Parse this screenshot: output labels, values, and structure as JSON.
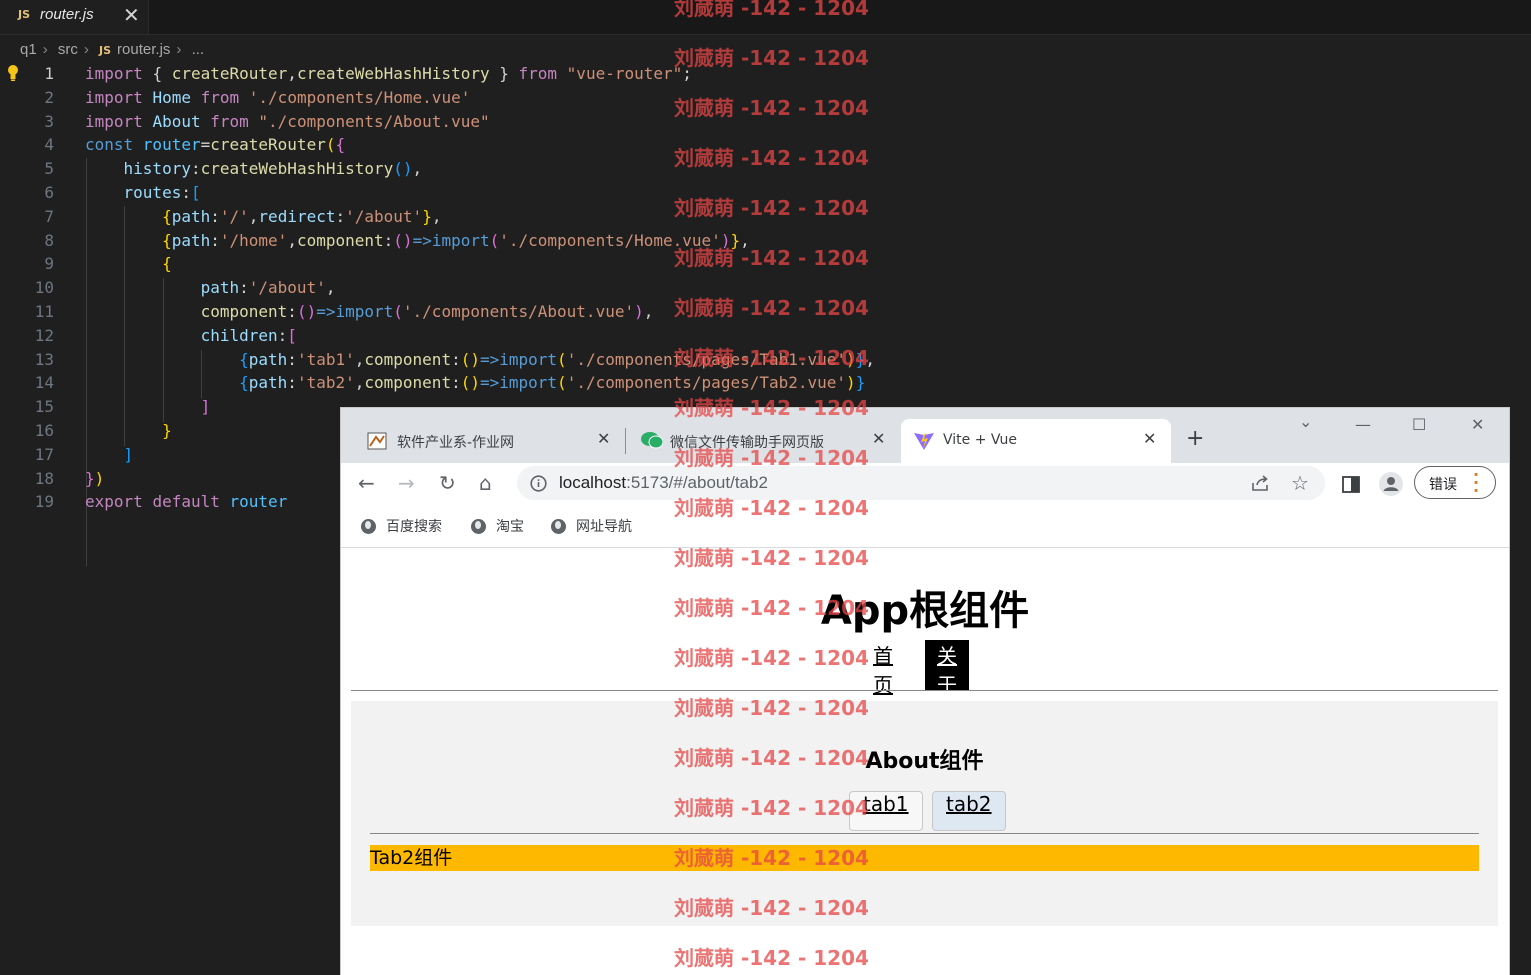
{
  "editor": {
    "tab_label": "router.js",
    "tab_lang": "JS",
    "tab_close": "✕",
    "breadcrumb": {
      "folder": "q1",
      "subfolder": "src",
      "lang": "JS",
      "file": "router.js",
      "more": "..."
    },
    "line_numbers": [
      "1",
      "2",
      "3",
      "4",
      "5",
      "6",
      "7",
      "8",
      "9",
      "10",
      "11",
      "12",
      "13",
      "14",
      "15",
      "16",
      "17",
      "18",
      "19"
    ],
    "code_lines": [
      [
        [
          "kw",
          "import "
        ],
        [
          "pl",
          "{ "
        ],
        [
          "fn",
          "createRouter"
        ],
        [
          "pl",
          ","
        ],
        [
          "fn",
          "createWebHashHistory"
        ],
        [
          "pl",
          " } "
        ],
        [
          "kw",
          "from "
        ],
        [
          "st",
          "\"vue-router\""
        ],
        [
          "pl",
          ";"
        ]
      ],
      [
        [
          "kw",
          "import "
        ],
        [
          "vr",
          "Home "
        ],
        [
          "kw",
          "from "
        ],
        [
          "st",
          "'./components/Home.vue'"
        ]
      ],
      [
        [
          "kw",
          "import "
        ],
        [
          "vr",
          "About "
        ],
        [
          "kw",
          "from "
        ],
        [
          "st",
          "\"./components/About.vue\""
        ]
      ],
      [
        [
          "kb",
          "const "
        ],
        [
          "cv",
          "router"
        ],
        [
          "pl",
          "="
        ],
        [
          "fn",
          "createRouter"
        ],
        [
          "b1",
          "("
        ],
        [
          "b2",
          "{"
        ]
      ],
      [
        [
          "pl",
          "    "
        ],
        [
          "vr",
          "history"
        ],
        [
          "pl",
          ":"
        ],
        [
          "fn",
          "createWebHashHistory"
        ],
        [
          "b3",
          "()"
        ],
        [
          "pl",
          ","
        ]
      ],
      [
        [
          "pl",
          "    "
        ],
        [
          "vr",
          "routes"
        ],
        [
          "pl",
          ":"
        ],
        [
          "b3",
          "["
        ]
      ],
      [
        [
          "pl",
          "        "
        ],
        [
          "b1",
          "{"
        ],
        [
          "vr",
          "path"
        ],
        [
          "pl",
          ":"
        ],
        [
          "st",
          "'/'"
        ],
        [
          "pl",
          ","
        ],
        [
          "vr",
          "redirect"
        ],
        [
          "pl",
          ":"
        ],
        [
          "st",
          "'/about'"
        ],
        [
          "b1",
          "}"
        ],
        [
          "pl",
          ","
        ]
      ],
      [
        [
          "pl",
          "        "
        ],
        [
          "b1",
          "{"
        ],
        [
          "vr",
          "path"
        ],
        [
          "pl",
          ":"
        ],
        [
          "st",
          "'/home'"
        ],
        [
          "pl",
          ","
        ],
        [
          "fn",
          "component"
        ],
        [
          "pl",
          ":"
        ],
        [
          "b2",
          "()"
        ],
        [
          "kb",
          "=>"
        ],
        [
          "kb",
          "import"
        ],
        [
          "b2",
          "("
        ],
        [
          "st",
          "'./components/Home.vue'"
        ],
        [
          "b2",
          ")"
        ],
        [
          "b1",
          "}"
        ],
        [
          "pl",
          ","
        ]
      ],
      [
        [
          "pl",
          "        "
        ],
        [
          "b1",
          "{"
        ]
      ],
      [
        [
          "pl",
          "            "
        ],
        [
          "vr",
          "path"
        ],
        [
          "pl",
          ":"
        ],
        [
          "st",
          "'/about'"
        ],
        [
          "pl",
          ","
        ]
      ],
      [
        [
          "pl",
          "            "
        ],
        [
          "fn",
          "component"
        ],
        [
          "pl",
          ":"
        ],
        [
          "b2",
          "()"
        ],
        [
          "kb",
          "=>"
        ],
        [
          "kb",
          "import"
        ],
        [
          "b2",
          "("
        ],
        [
          "st",
          "'./components/About.vue'"
        ],
        [
          "b2",
          ")"
        ],
        [
          "pl",
          ","
        ]
      ],
      [
        [
          "pl",
          "            "
        ],
        [
          "vr",
          "children"
        ],
        [
          "pl",
          ":"
        ],
        [
          "b2",
          "["
        ]
      ],
      [
        [
          "pl",
          "                "
        ],
        [
          "b3",
          "{"
        ],
        [
          "vr",
          "path"
        ],
        [
          "pl",
          ":"
        ],
        [
          "st",
          "'tab1'"
        ],
        [
          "pl",
          ","
        ],
        [
          "fn",
          "component"
        ],
        [
          "pl",
          ":"
        ],
        [
          "b1",
          "()"
        ],
        [
          "kb",
          "=>"
        ],
        [
          "kb",
          "import"
        ],
        [
          "b1",
          "("
        ],
        [
          "st",
          "'./components/pages/Tab1.vue'"
        ],
        [
          "b1",
          ")"
        ],
        [
          "b3",
          "}"
        ],
        [
          "pl",
          ","
        ]
      ],
      [
        [
          "pl",
          "                "
        ],
        [
          "b3",
          "{"
        ],
        [
          "vr",
          "path"
        ],
        [
          "pl",
          ":"
        ],
        [
          "st",
          "'tab2'"
        ],
        [
          "pl",
          ","
        ],
        [
          "fn",
          "component"
        ],
        [
          "pl",
          ":"
        ],
        [
          "b1",
          "()"
        ],
        [
          "kb",
          "=>"
        ],
        [
          "kb",
          "import"
        ],
        [
          "b1",
          "("
        ],
        [
          "st",
          "'./components/pages/Tab2.vue'"
        ],
        [
          "b1",
          ")"
        ],
        [
          "b3",
          "}"
        ]
      ],
      [
        [
          "pl",
          "            "
        ],
        [
          "b2",
          "]"
        ]
      ],
      [
        [
          "pl",
          "        "
        ],
        [
          "b1",
          "}"
        ]
      ],
      [
        [
          "pl",
          "    "
        ],
        [
          "b3",
          "]"
        ]
      ],
      [
        [
          "b2",
          "}"
        ],
        [
          "b1",
          ")"
        ]
      ],
      [
        [
          "kw",
          "export "
        ],
        [
          "kw",
          "default "
        ],
        [
          "cv",
          "router"
        ]
      ]
    ]
  },
  "browser": {
    "tabs": [
      {
        "label": "软件产业系-作业网",
        "close": "✕"
      },
      {
        "label": "微信文件传输助手网页版",
        "close": "✕"
      },
      {
        "label": "Vite + Vue",
        "close": "✕"
      }
    ],
    "new_tab": "+",
    "window_controls": {
      "dropdown": "⌄",
      "minimize": "—",
      "maximize": "☐",
      "close": "✕"
    },
    "nav": {
      "back": "←",
      "forward": "→",
      "reload": "↻",
      "home": "⌂"
    },
    "address": {
      "host": "localhost",
      "rest": ":5173/#/about/tab2"
    },
    "error_button": "错误",
    "bookmarks": [
      "百度搜索",
      "淘宝",
      "网址导航"
    ]
  },
  "app": {
    "title": "App根组件",
    "nav": [
      "首页",
      "关于"
    ],
    "about_heading": "About组件",
    "subtabs": [
      "tab1",
      "tab2"
    ],
    "tab_content": "Tab2组件"
  },
  "watermark": "刘蒇萌 -142 - 1204",
  "colors": {
    "editor_bg": "#1f1f1f",
    "tab2_bg": "#ffb800",
    "watermark": "#e64646"
  }
}
